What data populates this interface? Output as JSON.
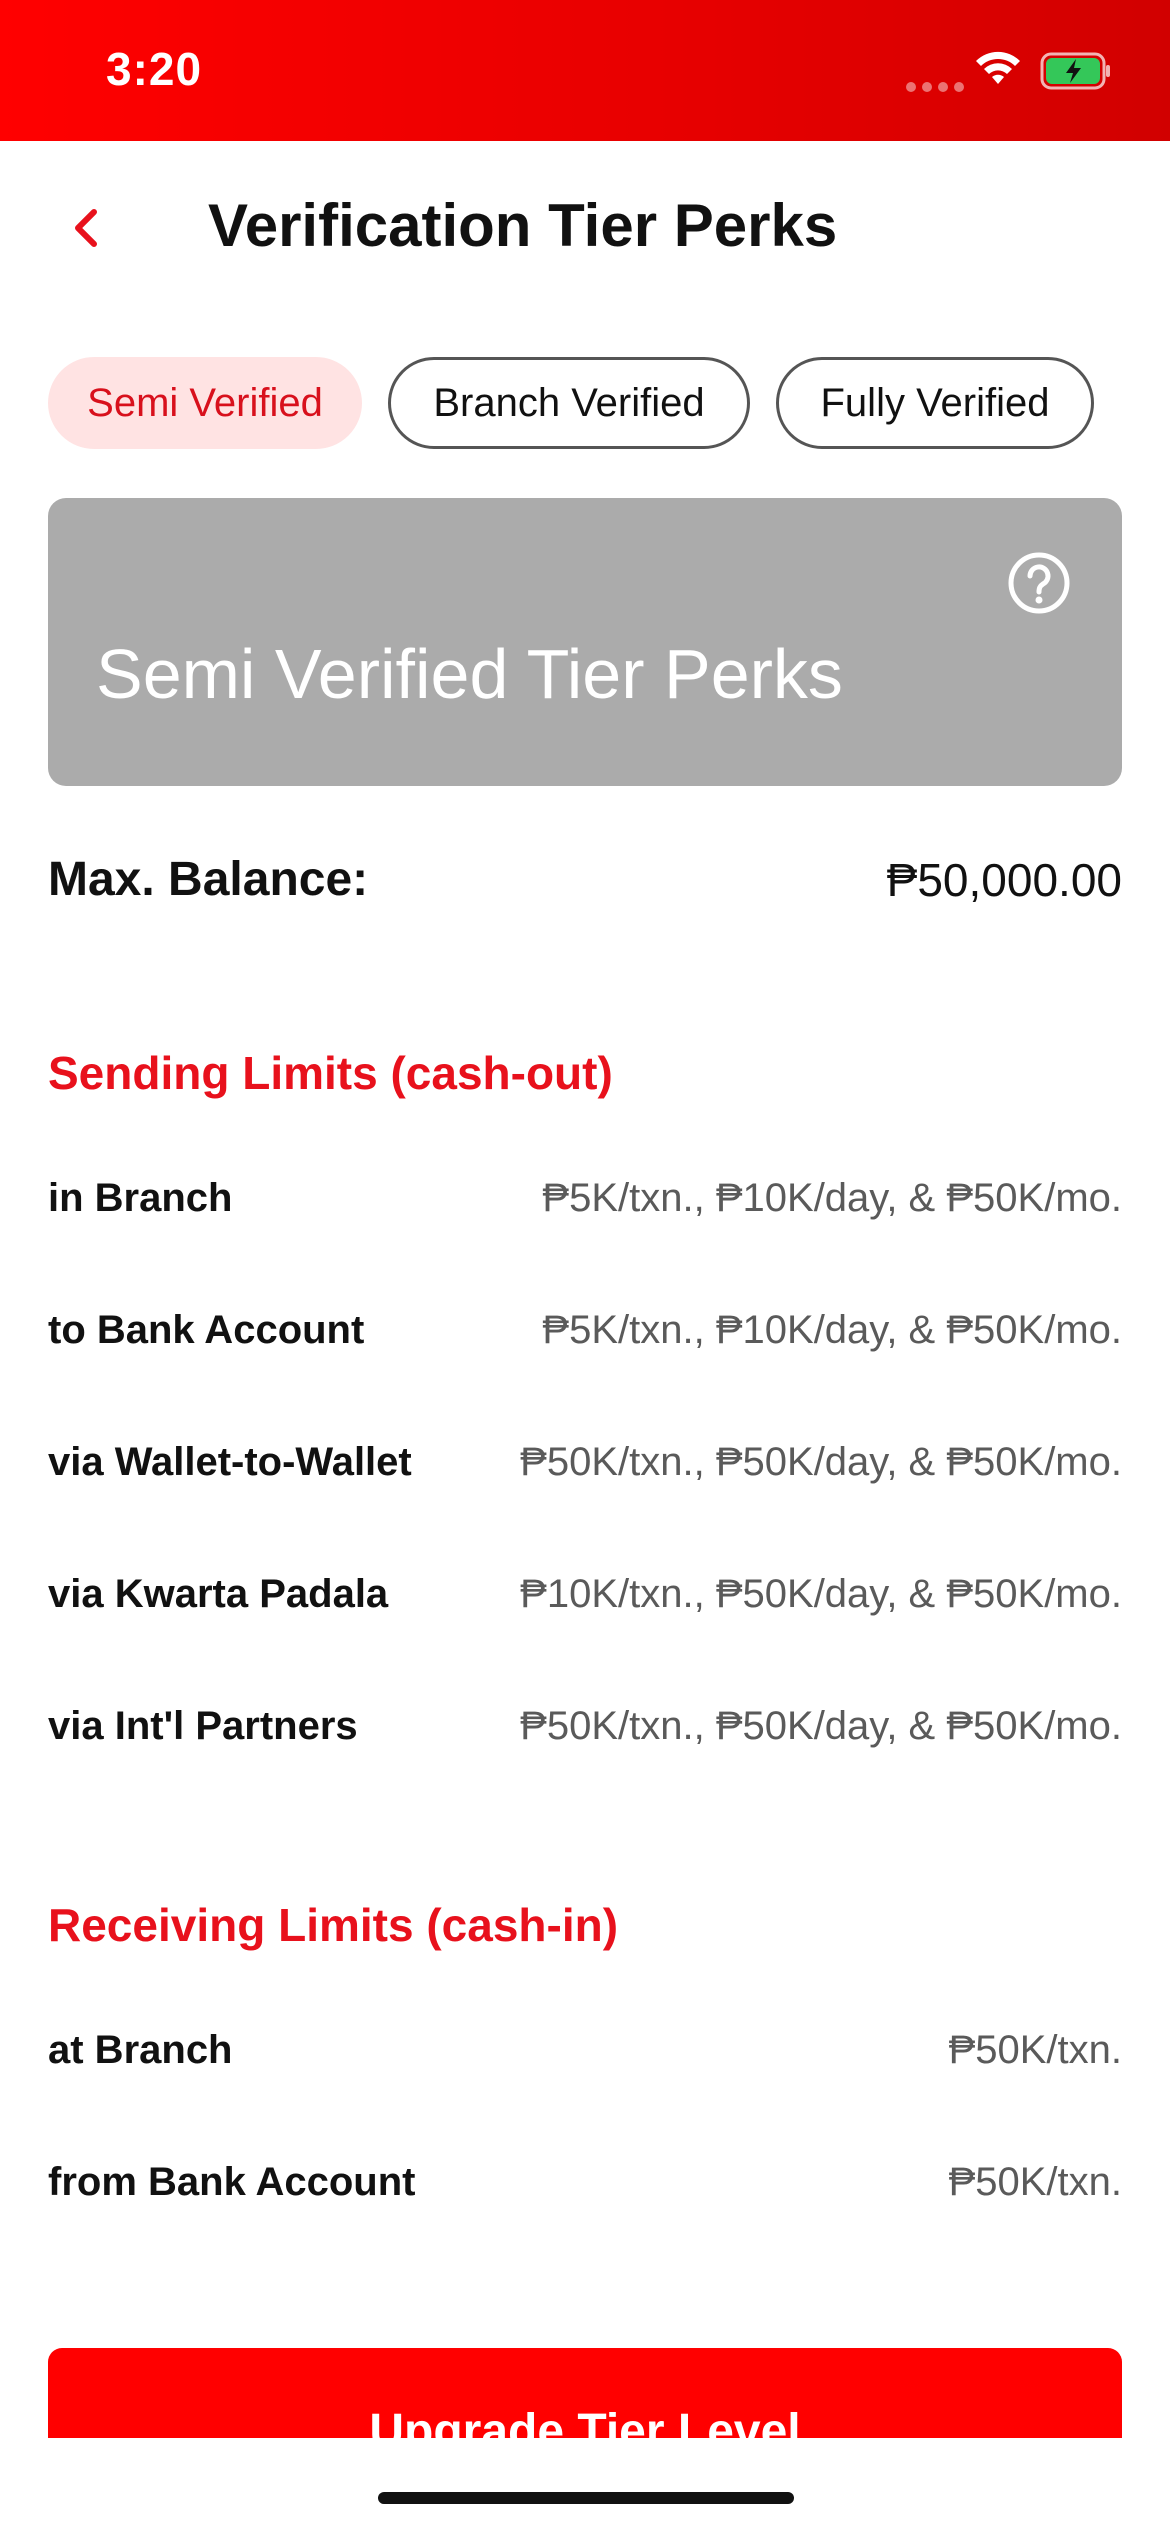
{
  "status_bar": {
    "time": "3:20",
    "icons": [
      "signal-dots-icon",
      "wifi-icon",
      "battery-charging-icon"
    ],
    "battery_color": "#34c759"
  },
  "header": {
    "back_icon": "chevron-left-icon",
    "title": "Verification Tier Perks"
  },
  "tabs": [
    {
      "label": "Semi Verified",
      "active": true
    },
    {
      "label": "Branch Verified",
      "active": false
    },
    {
      "label": "Fully Verified",
      "active": false
    }
  ],
  "hero": {
    "title": "Semi Verified Tier Perks",
    "help_icon": "question-circle-icon"
  },
  "max_balance": {
    "label": "Max. Balance:",
    "value": "₱50,000.00"
  },
  "sending": {
    "title": "Sending Limits (cash-out)",
    "rows": [
      {
        "label": "in Branch",
        "value": "₱5K/txn., ₱10K/day, & ₱50K/mo."
      },
      {
        "label": "to Bank Account",
        "value": "₱5K/txn., ₱10K/day, & ₱50K/mo."
      },
      {
        "label": "via Wallet-to-Wallet",
        "value": "₱50K/txn., ₱50K/day, & ₱50K/mo."
      },
      {
        "label": "via Kwarta Padala",
        "value": "₱10K/txn., ₱50K/day, & ₱50K/mo."
      },
      {
        "label": "via Int'l Partners",
        "value": "₱50K/txn., ₱50K/day, & ₱50K/mo."
      }
    ]
  },
  "receiving": {
    "title": "Receiving Limits (cash-in)",
    "rows": [
      {
        "label": "at Branch",
        "value": "₱50K/txn."
      },
      {
        "label": "from Bank Account",
        "value": "₱50K/txn."
      }
    ]
  },
  "cta": {
    "label": "Upgrade Tier Level"
  },
  "colors": {
    "brand_red": "#ff0000",
    "section_red": "#e8111c",
    "active_tab_bg": "#ffe3e3",
    "hero_bg": "#ababab"
  }
}
